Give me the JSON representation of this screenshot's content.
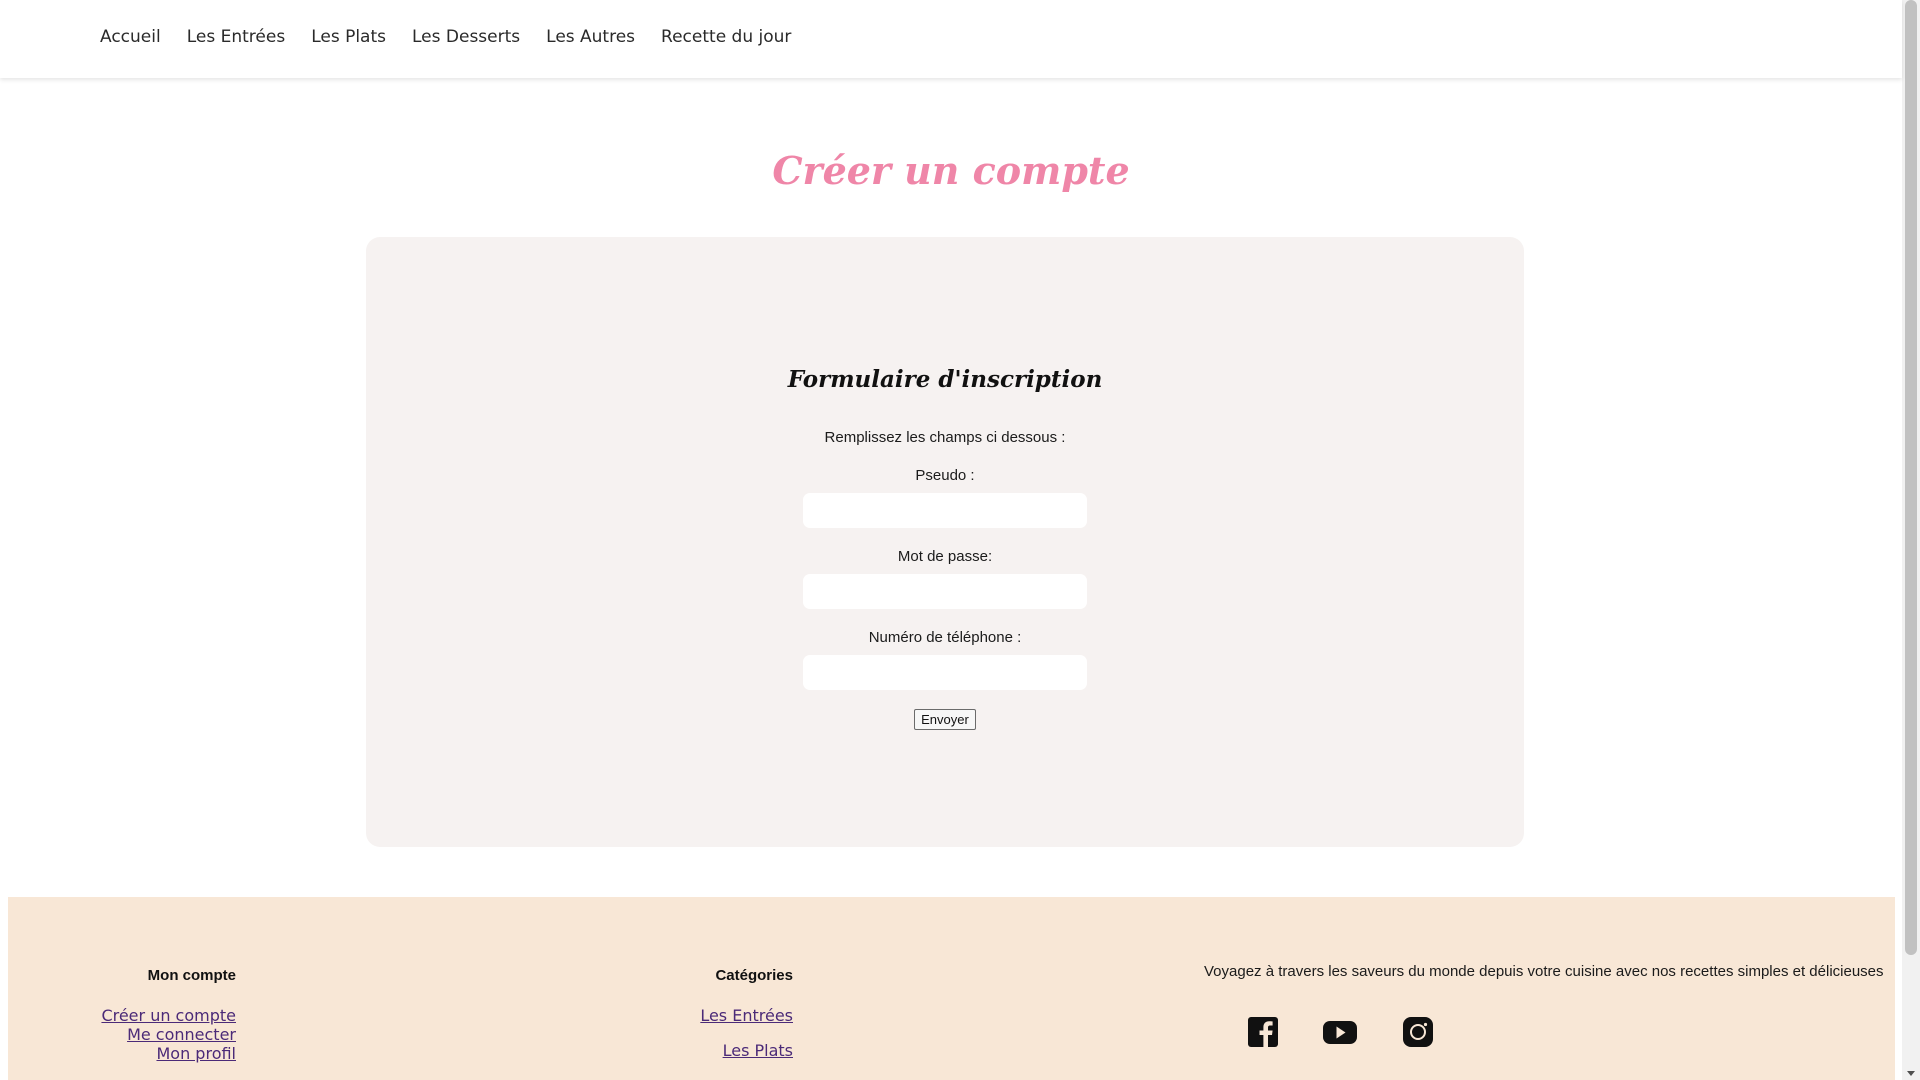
{
  "nav": {
    "items": [
      {
        "label": "Accueil"
      },
      {
        "label": "Les Entrées"
      },
      {
        "label": "Les Plats"
      },
      {
        "label": "Les Desserts"
      },
      {
        "label": "Les Autres"
      },
      {
        "label": "Recette du jour"
      }
    ]
  },
  "page": {
    "title": "Créer un compte",
    "title_color": "#ef86a8"
  },
  "form": {
    "heading": "Formulaire d'inscription",
    "intro": "Remplissez les champs ci dessous :",
    "fields": [
      {
        "label": "Pseudo :",
        "value": ""
      },
      {
        "label": "Mot de passe:",
        "value": ""
      },
      {
        "label": "Numéro de téléphone :",
        "value": ""
      }
    ],
    "submit_label": "Envoyer",
    "background": "#f6f2f1"
  },
  "footer": {
    "background": "#f8e7d6",
    "account": {
      "title": "Mon compte",
      "links": [
        "Créer un compte",
        "Me connecter",
        "Mon profil"
      ]
    },
    "categories": {
      "title": "Catégories",
      "links": [
        "Les Entrées",
        "Les Plats"
      ]
    },
    "tagline": "Voyagez à travers les saveurs du monde depuis votre cuisine avec nos recettes simples et délicieuses",
    "social": [
      "facebook-icon",
      "youtube-icon",
      "instagram-icon"
    ]
  }
}
